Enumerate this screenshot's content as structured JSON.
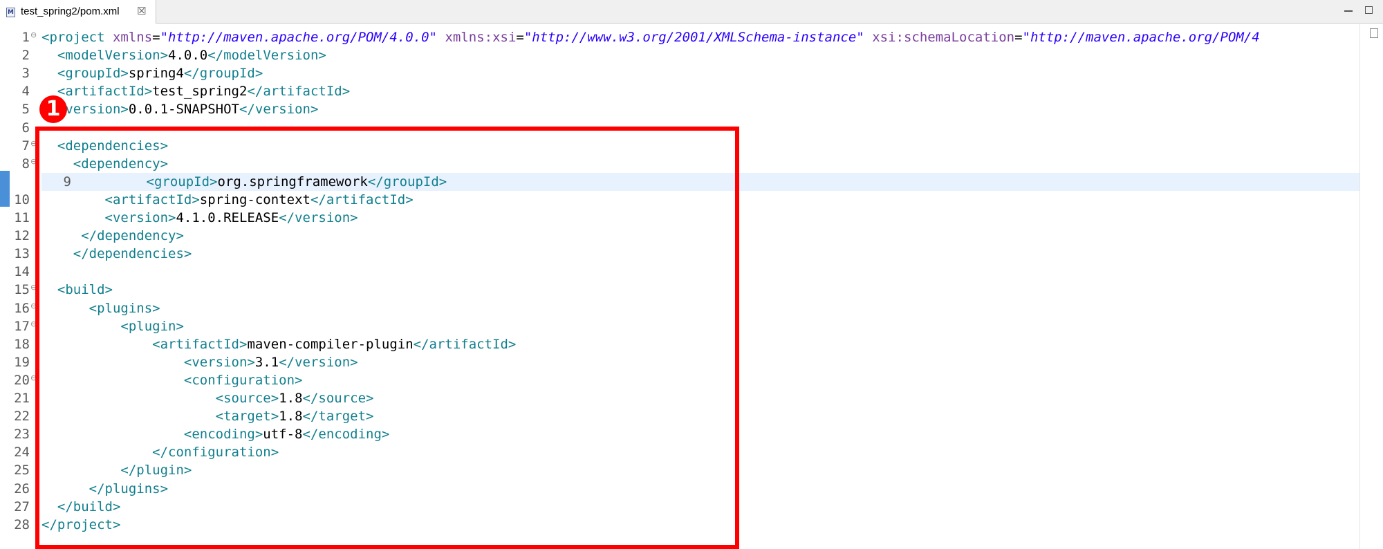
{
  "tab": {
    "title": "test_spring2/pom.xml",
    "icon": "maven-file-icon",
    "icon_letter": "M",
    "close": "☒"
  },
  "callout": {
    "number": "1"
  },
  "colors": {
    "tag": "#117f8e",
    "attribute": "#7a3e9d",
    "value": "#2a00ff",
    "highlight": "#ff0000"
  },
  "editor": {
    "current_line": 9,
    "lines": [
      {
        "n": "1",
        "fold": "⊖",
        "segs": [
          {
            "c": "t",
            "s": "<project "
          },
          {
            "c": "a",
            "s": "xmlns"
          },
          {
            "c": "",
            "s": "="
          },
          {
            "c": "v",
            "s": "\"http://maven.apache.org/POM/4.0.0\""
          },
          {
            "c": "",
            "s": " "
          },
          {
            "c": "a",
            "s": "xmlns:xsi"
          },
          {
            "c": "",
            "s": "="
          },
          {
            "c": "v",
            "s": "\"http://www.w3.org/2001/XMLSchema-instance\""
          },
          {
            "c": "",
            "s": " "
          },
          {
            "c": "a",
            "s": "xsi:schemaLocation"
          },
          {
            "c": "",
            "s": "="
          },
          {
            "c": "v",
            "s": "\"http://maven.apache.org/POM/4"
          }
        ]
      },
      {
        "n": "2",
        "segs": [
          {
            "c": "",
            "s": "  "
          },
          {
            "c": "t",
            "s": "<modelVersion>"
          },
          {
            "c": "",
            "s": "4.0.0"
          },
          {
            "c": "t",
            "s": "</modelVersion>"
          }
        ]
      },
      {
        "n": "3",
        "segs": [
          {
            "c": "",
            "s": "  "
          },
          {
            "c": "t",
            "s": "<groupId>"
          },
          {
            "c": "",
            "s": "spring4"
          },
          {
            "c": "t",
            "s": "</groupId>"
          }
        ]
      },
      {
        "n": "4",
        "segs": [
          {
            "c": "",
            "s": "  "
          },
          {
            "c": "t",
            "s": "<artifactId>"
          },
          {
            "c": "",
            "s": "test_spring2"
          },
          {
            "c": "t",
            "s": "</artifactId>"
          }
        ]
      },
      {
        "n": "5",
        "segs": [
          {
            "c": "",
            "s": "  "
          },
          {
            "c": "t",
            "s": "<version>"
          },
          {
            "c": "",
            "s": "0.0.1-SNAPSHOT"
          },
          {
            "c": "t",
            "s": "</version>"
          }
        ]
      },
      {
        "n": "6",
        "segs": []
      },
      {
        "n": "7",
        "fold": "⊖",
        "segs": [
          {
            "c": "",
            "s": "  "
          },
          {
            "c": "t",
            "s": "<dependencies>"
          }
        ]
      },
      {
        "n": "8",
        "fold": "⊖",
        "segs": [
          {
            "c": "",
            "s": "    "
          },
          {
            "c": "t",
            "s": "<dependency>"
          }
        ]
      },
      {
        "n": "9",
        "segs": [
          {
            "c": "",
            "s": "        "
          },
          {
            "c": "t",
            "s": "<groupId>"
          },
          {
            "c": "",
            "s": "org.springframework"
          },
          {
            "c": "t",
            "s": "</groupId>"
          }
        ]
      },
      {
        "n": "10",
        "segs": [
          {
            "c": "",
            "s": "        "
          },
          {
            "c": "t",
            "s": "<artifactId>"
          },
          {
            "c": "",
            "s": "spring-context"
          },
          {
            "c": "t",
            "s": "</artifactId>"
          }
        ]
      },
      {
        "n": "11",
        "segs": [
          {
            "c": "",
            "s": "        "
          },
          {
            "c": "t",
            "s": "<version>"
          },
          {
            "c": "",
            "s": "4.1.0.RELEASE"
          },
          {
            "c": "t",
            "s": "</version>"
          }
        ]
      },
      {
        "n": "12",
        "segs": [
          {
            "c": "",
            "s": "     "
          },
          {
            "c": "t",
            "s": "</dependency>"
          }
        ]
      },
      {
        "n": "13",
        "segs": [
          {
            "c": "",
            "s": "    "
          },
          {
            "c": "t",
            "s": "</dependencies>"
          }
        ]
      },
      {
        "n": "14",
        "segs": []
      },
      {
        "n": "15",
        "fold": "⊖",
        "segs": [
          {
            "c": "",
            "s": "  "
          },
          {
            "c": "t",
            "s": "<build>"
          }
        ]
      },
      {
        "n": "16",
        "fold": "⊖",
        "segs": [
          {
            "c": "",
            "s": "      "
          },
          {
            "c": "t",
            "s": "<plugins>"
          }
        ]
      },
      {
        "n": "17",
        "fold": "⊖",
        "segs": [
          {
            "c": "",
            "s": "          "
          },
          {
            "c": "t",
            "s": "<plugin>"
          }
        ]
      },
      {
        "n": "18",
        "segs": [
          {
            "c": "",
            "s": "              "
          },
          {
            "c": "t",
            "s": "<artifactId>"
          },
          {
            "c": "",
            "s": "maven-compiler-plugin"
          },
          {
            "c": "t",
            "s": "</artifactId>"
          }
        ]
      },
      {
        "n": "19",
        "segs": [
          {
            "c": "",
            "s": "                  "
          },
          {
            "c": "t",
            "s": "<version>"
          },
          {
            "c": "",
            "s": "3.1"
          },
          {
            "c": "t",
            "s": "</version>"
          }
        ]
      },
      {
        "n": "20",
        "fold": "⊖",
        "segs": [
          {
            "c": "",
            "s": "                  "
          },
          {
            "c": "t",
            "s": "<configuration>"
          }
        ]
      },
      {
        "n": "21",
        "segs": [
          {
            "c": "",
            "s": "                      "
          },
          {
            "c": "t",
            "s": "<source>"
          },
          {
            "c": "",
            "s": "1.8"
          },
          {
            "c": "t",
            "s": "</source>"
          }
        ]
      },
      {
        "n": "22",
        "segs": [
          {
            "c": "",
            "s": "                      "
          },
          {
            "c": "t",
            "s": "<target>"
          },
          {
            "c": "",
            "s": "1.8"
          },
          {
            "c": "t",
            "s": "</target>"
          }
        ]
      },
      {
        "n": "23",
        "segs": [
          {
            "c": "",
            "s": "                  "
          },
          {
            "c": "t",
            "s": "<encoding>"
          },
          {
            "c": "",
            "s": "utf-8"
          },
          {
            "c": "t",
            "s": "</encoding>"
          }
        ]
      },
      {
        "n": "24",
        "segs": [
          {
            "c": "",
            "s": "              "
          },
          {
            "c": "t",
            "s": "</configuration>"
          }
        ]
      },
      {
        "n": "25",
        "segs": [
          {
            "c": "",
            "s": "          "
          },
          {
            "c": "t",
            "s": "</plugin>"
          }
        ]
      },
      {
        "n": "26",
        "segs": [
          {
            "c": "",
            "s": "      "
          },
          {
            "c": "t",
            "s": "</plugins>"
          }
        ]
      },
      {
        "n": "27",
        "segs": [
          {
            "c": "",
            "s": "  "
          },
          {
            "c": "t",
            "s": "</build>"
          }
        ]
      },
      {
        "n": "28",
        "segs": [
          {
            "c": "t",
            "s": "</project>"
          }
        ]
      }
    ]
  }
}
